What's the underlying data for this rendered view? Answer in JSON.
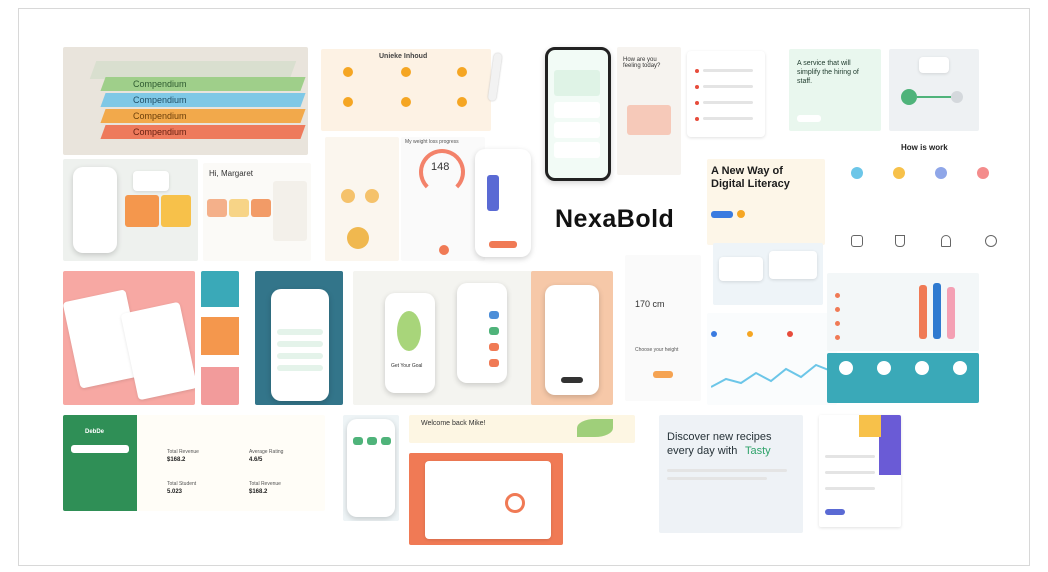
{
  "brand": {
    "title": "NexaBold"
  },
  "tiles": {
    "books": {
      "label": "Compendium"
    },
    "unieke": {
      "title": "Unieke Inhoud"
    },
    "weight": {
      "title": "My weight loss progress",
      "value": "148"
    },
    "hi": {
      "greeting": "Hi, Margaret"
    },
    "feeling": {
      "title": "How are you feeling today?"
    },
    "service": {
      "title": "A service that will simplify the hiring of staff."
    },
    "howwork": {
      "title": "How is work"
    },
    "literacy": {
      "title": "A New Way of Digital Literacy"
    },
    "height": {
      "value": "170 cm",
      "prompt": "Choose your height"
    },
    "eatclean": {
      "title": "Get Your Goal"
    },
    "welcome": {
      "title": "Welcome back Mike!"
    },
    "tasty": {
      "line1": "Discover new recipes",
      "line2": "every day with",
      "brand": "Tasty"
    },
    "dash": {
      "logo": "DebDe",
      "total_revenue_label": "Total Revenue",
      "total_revenue_value": "$168.2",
      "avg_rating_label": "Average Rating",
      "avg_rating_value": "4.6/5",
      "total_student_label": "Total Student",
      "total_student_value": "5.023",
      "total_revenue2_label": "Total Revenue",
      "total_revenue2_value": "$168.2"
    }
  },
  "colors": {
    "teal": "#3aa9b8",
    "coral": "#f07a55",
    "green": "#4fb37a",
    "mint": "#e8f5ec",
    "peach": "#fde9d5"
  }
}
